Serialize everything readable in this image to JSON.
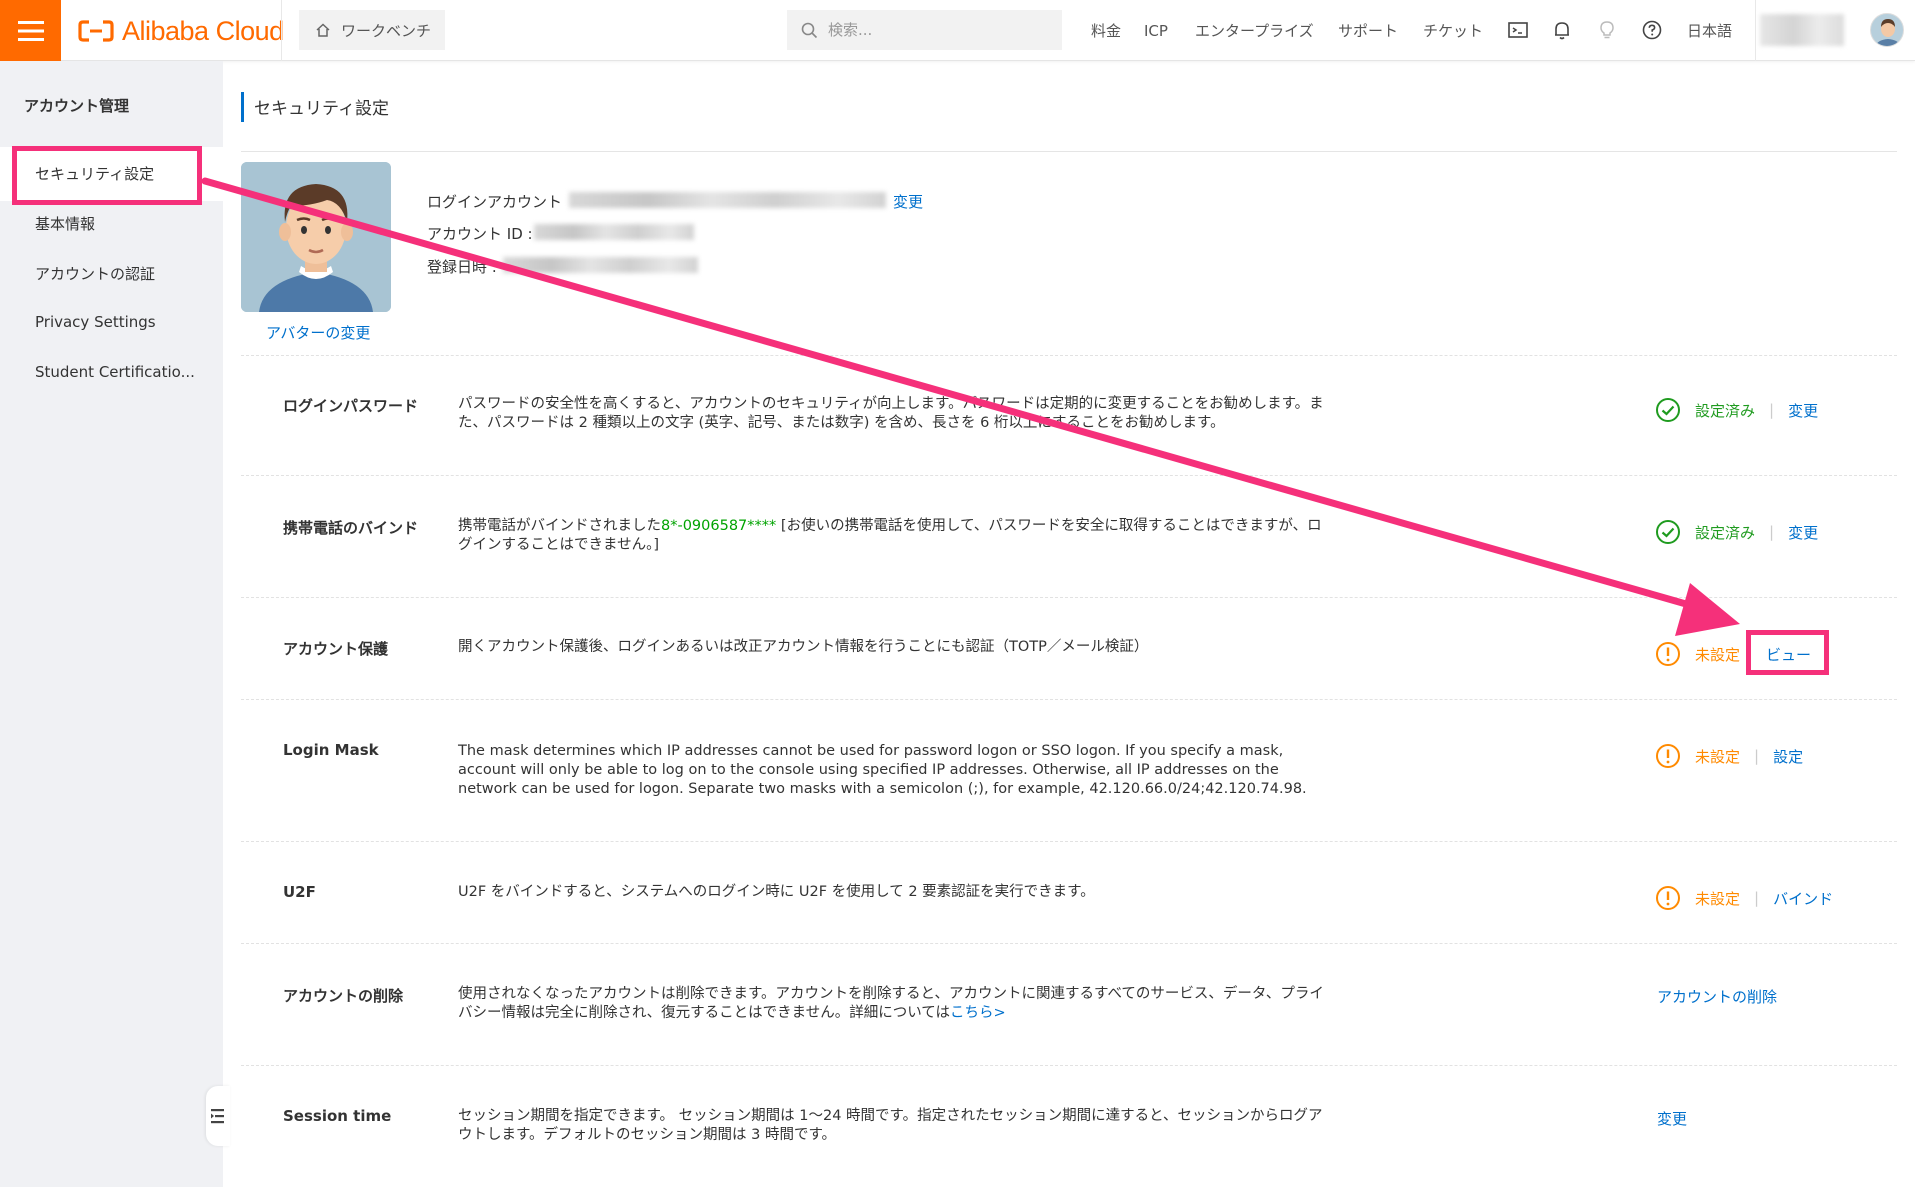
{
  "header": {
    "brand": "Alibaba Cloud",
    "workbench_label": "ワークベンチ",
    "search_placeholder": "検索...",
    "nav": [
      "料金",
      "ICP",
      "エンタープライズ",
      "サポート",
      "チケット"
    ],
    "language": "日本語",
    "icons": [
      "terminal-icon",
      "bell-icon",
      "lightbulb-icon",
      "help-icon"
    ]
  },
  "sidebar": {
    "title": "アカウント管理",
    "items": [
      "セキュリティ設定",
      "基本情報",
      "アカウントの認証",
      "Privacy Settings",
      "Student Certificatio..."
    ]
  },
  "main": {
    "page_title": "セキュリティ設定",
    "profile": {
      "login_account_label": "ログインアカウント",
      "change_label": "変更",
      "account_id_label": "アカウント ID :",
      "registered_label": "登録日時 :",
      "avatar_change": "アバターの変更"
    },
    "rows": [
      {
        "title": "ログインパスワード",
        "desc": "パスワードの安全性を高くすると、アカウントのセキュリティが向上します。パスワードは定期的に変更することをお勧めします。また、パスワードは 2 種類以上の文字 (英字、記号、または数字) を含め、長さを 6 桁以上にすることをお勧めします。",
        "status": "設定済み",
        "action": "変更"
      },
      {
        "title": "携帯電話のバインド",
        "desc_prefix": "携帯電話がバインドされました",
        "phone": "8*-0906587****",
        "desc_suffix": " [お使いの携帯電話を使用して、パスワードを安全に取得することはできますが、ログインすることはできません。]",
        "status": "設定済み",
        "action": "変更"
      },
      {
        "title": "アカウント保護",
        "desc": "開くアカウント保護後、ログインあるいは改正アカウント情報を行うことにも認証（TOTP／メール検証）",
        "status": "未設定",
        "action": "ビュー"
      },
      {
        "title": "Login Mask",
        "desc": "The mask determines which IP addresses cannot be used for password logon or SSO logon. If you specify a mask, account will only be able to log on to the console using specified IP addresses. Otherwise, all IP addresses on the network can be used for logon. Separate two masks with a semicolon (;), for example, 42.120.66.0/24;42.120.74.98.",
        "status": "未設定",
        "action": "設定"
      },
      {
        "title": "U2F",
        "desc": "U2F をバインドすると、システムへのログイン時に U2F を使用して 2 要素認証を実行できます。",
        "status": "未設定",
        "action": "バインド"
      },
      {
        "title": "アカウントの削除",
        "desc": "使用されなくなったアカウントは削除できます。アカウントを削除すると、アカウントに関連するすべてのサービス、データ、プライバシー情報は完全に削除され、復元することはできません。詳細については",
        "desc_link": "こちら>",
        "action": "アカウントの削除"
      },
      {
        "title": "Session time",
        "desc": "セッション期間を指定できます。 セッション期間は 1〜24 時間です。指定されたセッション期間に達すると、セッションからログアウトします。デフォルトのセッション期間は 3 時間です。",
        "action": "変更"
      }
    ]
  },
  "colors": {
    "brand_orange": "#ff6a00",
    "link_blue": "#0070cc",
    "ok_green": "#1f9b1f",
    "warn_orange": "#ff8a00",
    "annotation_pink": "#f5307a",
    "sidebar_bg": "#f0f1f4"
  }
}
